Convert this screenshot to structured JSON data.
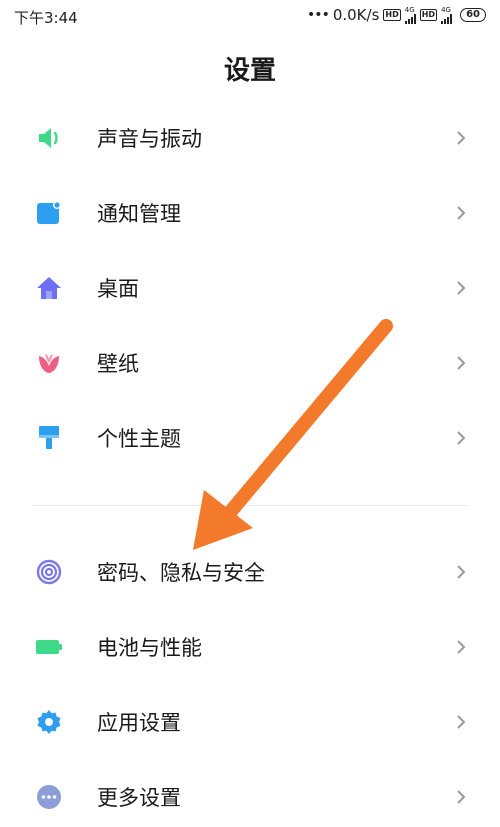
{
  "status_bar": {
    "time": "下午3:44",
    "net_speed": "0.0K/s",
    "hd_label": "HD",
    "network_type": "4G",
    "battery": "60"
  },
  "header": {
    "title": "设置"
  },
  "settings": {
    "items": [
      {
        "label": "声音与振动",
        "icon": "speaker-icon",
        "color": "#3fd98a"
      },
      {
        "label": "通知管理",
        "icon": "notification-icon",
        "color": "#2d9ef0"
      },
      {
        "label": "桌面",
        "icon": "home-icon",
        "color": "#6e6ff2"
      },
      {
        "label": "壁纸",
        "icon": "tulip-icon",
        "color": "#ee5f84"
      },
      {
        "label": "个性主题",
        "icon": "paintbrush-icon",
        "color": "#2aa0ef"
      },
      {
        "label": "密码、隐私与安全",
        "icon": "fingerprint-icon",
        "color": "#7a77e8"
      },
      {
        "label": "电池与性能",
        "icon": "battery-icon",
        "color": "#3fd98a"
      },
      {
        "label": "应用设置",
        "icon": "gear-icon",
        "color": "#2d9ef0"
      },
      {
        "label": "更多设置",
        "icon": "more-icon",
        "color": "#8c9ed8"
      }
    ]
  },
  "annotation": {
    "arrow_color": "#f27a2a"
  }
}
